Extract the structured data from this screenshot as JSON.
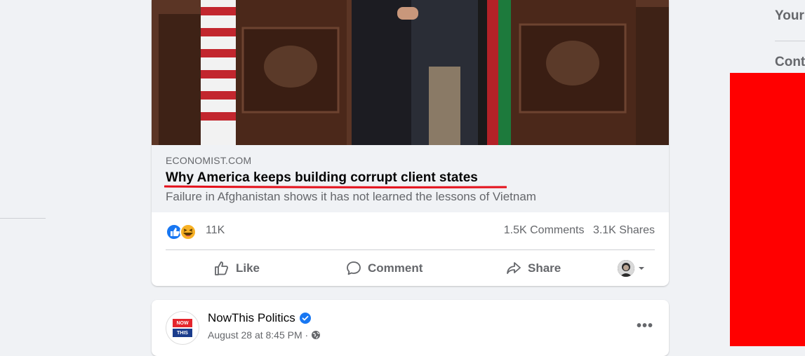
{
  "post": {
    "link_domain": "ECONOMIST.COM",
    "link_title": "Why America keeps building corrupt client states",
    "link_subtitle": "Failure in Afghanistan shows it has not learned the lessons of Vietnam",
    "reactions_count": "11K",
    "comments_count": "1.5K Comments",
    "shares_count": "3.1K Shares",
    "actions": {
      "like": "Like",
      "comment": "Comment",
      "share": "Share"
    },
    "reaction_icons": [
      "like-reaction-icon",
      "haha-reaction-icon"
    ]
  },
  "next_post": {
    "page_name": "NowThis Politics",
    "verified": true,
    "meta": "August 28 at 8:45 PM ·",
    "avatar_text": {
      "top": "NOW",
      "bottom": "THIS"
    },
    "audience_icon": "globe-icon"
  },
  "right_sidebar": {
    "heading1": "Your",
    "heading2": "Cont"
  },
  "colors": {
    "accent": "#1877f2",
    "annotation_underline": "#e4101a",
    "overlay_block": "#ff0000"
  }
}
